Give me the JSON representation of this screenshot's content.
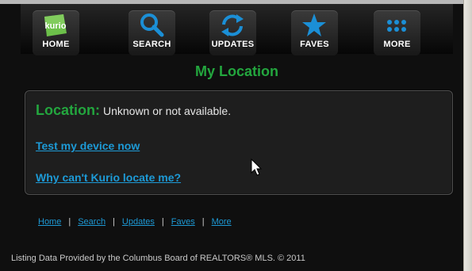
{
  "nav": {
    "buttons": [
      {
        "label": "HOME",
        "icon": "kurio-logo-icon",
        "logo_text": "kurio"
      },
      {
        "label": "SEARCH",
        "icon": "search-icon"
      },
      {
        "label": "UPDATES",
        "icon": "refresh-icon"
      },
      {
        "label": "FAVES",
        "icon": "star-icon"
      },
      {
        "label": "MORE",
        "icon": "more-dots-icon"
      }
    ]
  },
  "page": {
    "title": "My Location"
  },
  "location": {
    "label": "Location:",
    "value": "Unknown or not available."
  },
  "links": {
    "test_device": "Test my device now",
    "why_cant_locate": "Why can't Kurio locate me?"
  },
  "footer": {
    "nav": [
      "Home",
      "Search",
      "Updates",
      "Faves",
      "More"
    ],
    "separator": "|",
    "disclaimer": "Listing Data Provided by the Columbus Board of REALTORS® MLS. © 2011"
  },
  "colors": {
    "accent_green": "#23a63e",
    "link_blue": "#1d9ad6",
    "icon_blue": "#1b8fd6",
    "background": "#0f0f0f"
  }
}
